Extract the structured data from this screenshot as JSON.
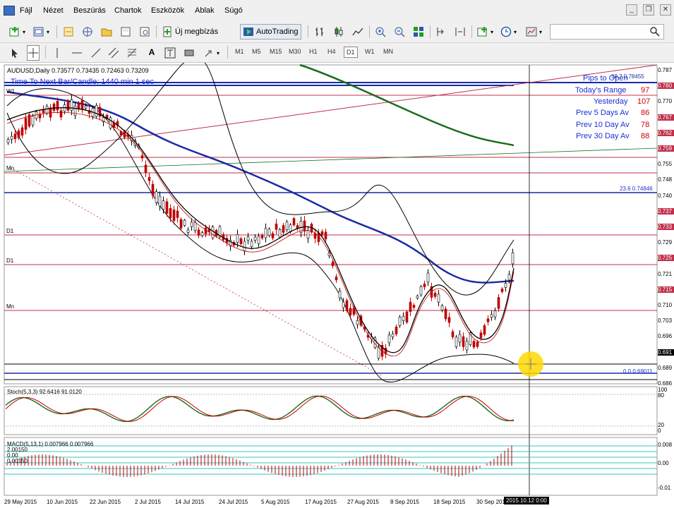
{
  "menu": {
    "items": [
      "Fájl",
      "Nézet",
      "Beszúrás",
      "Chartok",
      "Eszközök",
      "Ablak",
      "Súgó"
    ]
  },
  "toolbar": {
    "new_order_label": "Új megbízás",
    "autotrading_label": "AutoTrading",
    "search_placeholder": ""
  },
  "timeframes": [
    "M1",
    "M5",
    "M15",
    "M30",
    "H1",
    "H4",
    "D1",
    "W1",
    "MN"
  ],
  "active_timeframe": "D1",
  "chart": {
    "symbol_line": "AUDUSD,Daily  0.73577 0.73435 0.72463 0.73209",
    "time_to_next_bar": "Time To Next Bar/Candle: 1440 min 1 sec",
    "info": [
      {
        "label": "Pips to Open",
        "value": ""
      },
      {
        "label": "Today's Range",
        "value": "97"
      },
      {
        "label": "Yesterday",
        "value": "107"
      },
      {
        "label": "Prev 5 Days Av",
        "value": "86"
      },
      {
        "label": "Prev 10 Day Av",
        "value": "78"
      },
      {
        "label": "Prev 30 Day Av",
        "value": "88"
      }
    ],
    "level_labels": [
      "W1",
      "Mn",
      "D1",
      "D1",
      "Mn"
    ],
    "fib_top": "38.2 0.78455",
    "fib_mid": "23.6 0.74846",
    "fib_bottom": "0.0 0.69011",
    "price_labels": [
      "0.787",
      "0.780",
      "0.770",
      "0.767",
      "0.762",
      "0.759",
      "0.755",
      "0.748",
      "0.740",
      "0.737",
      "0.733",
      "0.729",
      "0.725",
      "0.721",
      "0.715",
      "0.710",
      "0.703",
      "0.696",
      "0.691",
      "0.689",
      "0.686"
    ],
    "stoch_label": "Stoch(5,3,3) 92.6416 91.0120",
    "stoch_levels": [
      "100",
      "80",
      "20",
      "0"
    ],
    "macd_label": "MACD(5,13,1) 0.007966 0.007966",
    "macd_levels": [
      "0.008",
      "0.00",
      "-0.01"
    ],
    "macd_left_levels": [
      "2.00150",
      "0.00",
      "0.00150"
    ],
    "dates": [
      "29 May 2015",
      "10 Jun 2015",
      "22 Jun 2015",
      "2 Jul 2015",
      "14 Jul 2015",
      "24 Jul 2015",
      "5 Aug 2015",
      "17 Aug 2015",
      "27 Aug 2015",
      "8 Sep 2015",
      "18 Sep 2015",
      "30 Sep 2015"
    ],
    "cursor_time": "2015.10.12 0:00",
    "colors": {
      "background": "#ffffff",
      "bull_candle": "#000000",
      "bear_candle": "#c00000",
      "ma_blue": "#1a2aa6",
      "ma_green": "#1d6b1d",
      "level_line": "#c0304a",
      "fib_line": "#1a2aa6",
      "stoch_main": "#1d6b1d",
      "stoch_signal": "#c00000",
      "macd_hist": "#c00000",
      "macd_levels": "#39c6c6",
      "cursor_highlight": "#ffd800"
    }
  }
}
